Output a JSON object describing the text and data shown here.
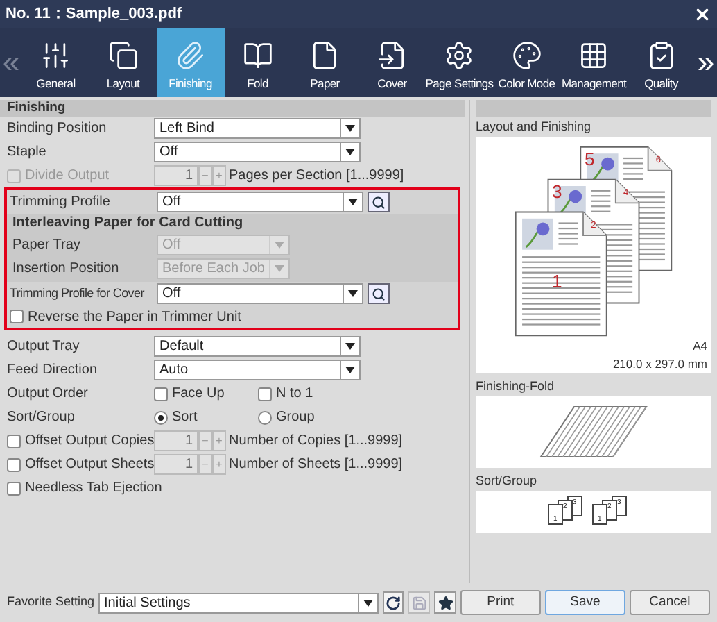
{
  "window": {
    "title": "No. 11：Sample_003.pdf"
  },
  "toolbar": {
    "prev": "«",
    "next": "»",
    "tabs": [
      {
        "label": "General",
        "selected": false
      },
      {
        "label": "Layout",
        "selected": false
      },
      {
        "label": "Finishing",
        "selected": true
      },
      {
        "label": "Fold",
        "selected": false
      },
      {
        "label": "Paper",
        "selected": false
      },
      {
        "label": "Cover",
        "selected": false
      },
      {
        "label": "Page Settings",
        "selected": false
      },
      {
        "label": "Color Mode",
        "selected": false
      },
      {
        "label": "Management",
        "selected": false
      },
      {
        "label": "Quality",
        "selected": false
      }
    ]
  },
  "left": {
    "title": "Finishing",
    "top": [
      {
        "kind": "select",
        "label": "Binding Position",
        "value": "Left Bind"
      },
      {
        "kind": "select",
        "label": "Staple",
        "value": "Off"
      },
      {
        "kind": "spin",
        "label": "Divide Output",
        "checked": false,
        "disabled": true,
        "value": "1",
        "minus": "−",
        "plus": "+",
        "unit": "Pages per Section [1...9999]"
      }
    ],
    "trimming": {
      "profile": {
        "label": "Trimming Profile",
        "value": "Off"
      },
      "interleave": {
        "title": "Interleaving Paper for Card Cutting",
        "fields": [
          {
            "label": "Paper Tray",
            "value": "Off",
            "disabled": true
          },
          {
            "label": "Insertion Position",
            "value": "Before Each Job",
            "disabled": true
          }
        ]
      },
      "cover": {
        "label": "Trimming Profile for Cover",
        "value": "Off"
      },
      "reverse": {
        "label": "Reverse the Paper in Trimmer Unit",
        "checked": false
      }
    },
    "bottom": [
      {
        "kind": "select",
        "label": "Output Tray",
        "value": "Default"
      },
      {
        "kind": "select",
        "label": "Feed Direction",
        "value": "Auto"
      },
      {
        "kind": "checks",
        "label": "Output Order",
        "options": [
          {
            "label": "Face Up",
            "checked": false
          },
          {
            "label": "N to 1",
            "checked": false
          }
        ]
      },
      {
        "kind": "radios",
        "label": "Sort/Group",
        "options": [
          {
            "label": "Sort",
            "selected": true
          },
          {
            "label": "Group",
            "selected": false
          }
        ]
      },
      {
        "kind": "spin",
        "label": "Offset Output Copies",
        "checked": false,
        "disabled": false,
        "value": "1",
        "minus": "−",
        "plus": "+",
        "unit": "Number of Copies [1...9999]"
      },
      {
        "kind": "spin",
        "label": "Offset Output Sheets",
        "checked": false,
        "disabled": false,
        "value": "1",
        "minus": "−",
        "plus": "+",
        "unit": "Number of Sheets [1...9999]"
      },
      {
        "kind": "check",
        "label": "Needless Tab Ejection",
        "checked": false
      }
    ]
  },
  "preview": {
    "layout": {
      "title": "Layout and Finishing",
      "front_numbers": [
        "1",
        "3",
        "5"
      ],
      "back_numbers": [
        "2",
        "4",
        "6"
      ],
      "paper": "A4",
      "size": "210.0 x 297.0 mm"
    },
    "fold": {
      "title": "Finishing-Fold"
    },
    "sort": {
      "title": "Sort/Group",
      "stacks": [
        [
          "1",
          "2",
          "3"
        ],
        [
          "1",
          "2",
          "3"
        ]
      ]
    }
  },
  "footer": {
    "label": "Favorite Setting",
    "value": "Initial Settings",
    "buttons": [
      {
        "label": "Print",
        "selected": false
      },
      {
        "label": "Save",
        "selected": true
      },
      {
        "label": "Cancel",
        "selected": false
      }
    ]
  }
}
